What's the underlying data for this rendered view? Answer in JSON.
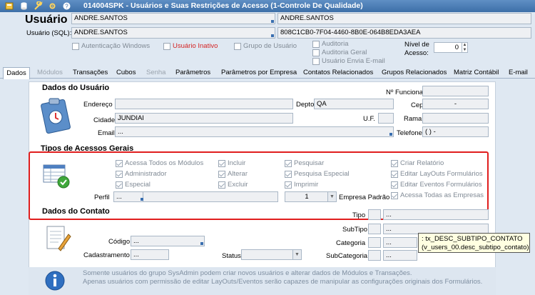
{
  "window": {
    "title": "014004SPK - Usuários e Suas Restrições de Acesso (1-Controle De Qualidade)"
  },
  "header": {
    "usuario_label": "Usuário",
    "usuario_value": "ANDRE.SANTOS",
    "usuario_name": "ANDRE.SANTOS",
    "usuario_sql_label": "Usuário (SQL):",
    "usuario_sql_value": "ANDRE.SANTOS",
    "guid": "808C1CB0-7F04-4460-8B0E-064B8EDA3AEA",
    "auth_windows": "Autenticação Windows",
    "usuario_inativo": "Usuário Inativo",
    "grupo_usuario": "Grupo de Usuário",
    "auditoria": "Auditoria",
    "auditoria_geral": "Auditoria Geral",
    "usuario_envia_email": "Usuário Envia E-mail",
    "nivel_label": "Nível de Acesso:",
    "nivel_value": "0"
  },
  "tabs": [
    "Dados",
    "Módulos",
    "Transações",
    "Cubos",
    "Senha",
    "Parâmetros",
    "Parâmetros por Empresa",
    "Contatos Relacionados",
    "Grupos Relacionados",
    "Matriz Contábil",
    "E-mail"
  ],
  "dados_usuario": {
    "title": "Dados do Usuário",
    "endereco": "Endereço",
    "depto": "Depto",
    "depto_value": "QA",
    "cidade": "Cidade",
    "cidade_value": "JUNDIAI",
    "uf": "U.F.",
    "email": "Email",
    "email_value": "...",
    "n_funcional": "Nº Funcional",
    "cep": "Cep",
    "cep_value": "-",
    "ramal": "Ramal",
    "telefone": "Telefone",
    "telefone_value": "(   )    -"
  },
  "acessos": {
    "title": "Tipos de Acessos Gerais",
    "col1": [
      "Acessa Todos os Módulos",
      "Administrador",
      "Especial"
    ],
    "col2": [
      "Incluir",
      "Alterar",
      "Excluir"
    ],
    "col3": [
      "Pesquisar",
      "Pesquisa Especial",
      "Imprimir"
    ],
    "col4": [
      "Criar Relatório",
      "Editar LayOuts Formulários",
      "Editar Eventos Formulários",
      "Acessa Todas as Empresas"
    ],
    "perfil_label": "Perfil",
    "perfil_value": "...",
    "empresa_value": "1",
    "empresa_label": "Empresa Padrão"
  },
  "contato": {
    "title": "Dados do Contato",
    "tipo": "Tipo",
    "subtipo": "SubTipo",
    "categoria": "Categoria",
    "subcategoria": "SubCategoria",
    "codigo": "Código",
    "codigo_value": "...",
    "cadastramento": "Cadastramento",
    "cadastramento_value": "...",
    "status": "Status",
    "ellipsis": "..."
  },
  "info": {
    "line1": "Somente usuários do grupo SysAdmin podem criar novos usuários e alterar dados de Módulos e Transações.",
    "line2": "Apenas usuários com permissão de editar LayOuts/Eventos serão capazes de manipular as configurações originais dos Formulários."
  },
  "tooltip": {
    "line1": ": tx_DESC_SUBTIPO_CONTATO",
    "line2": "(v_users_00.desc_subtipo_contato)"
  }
}
